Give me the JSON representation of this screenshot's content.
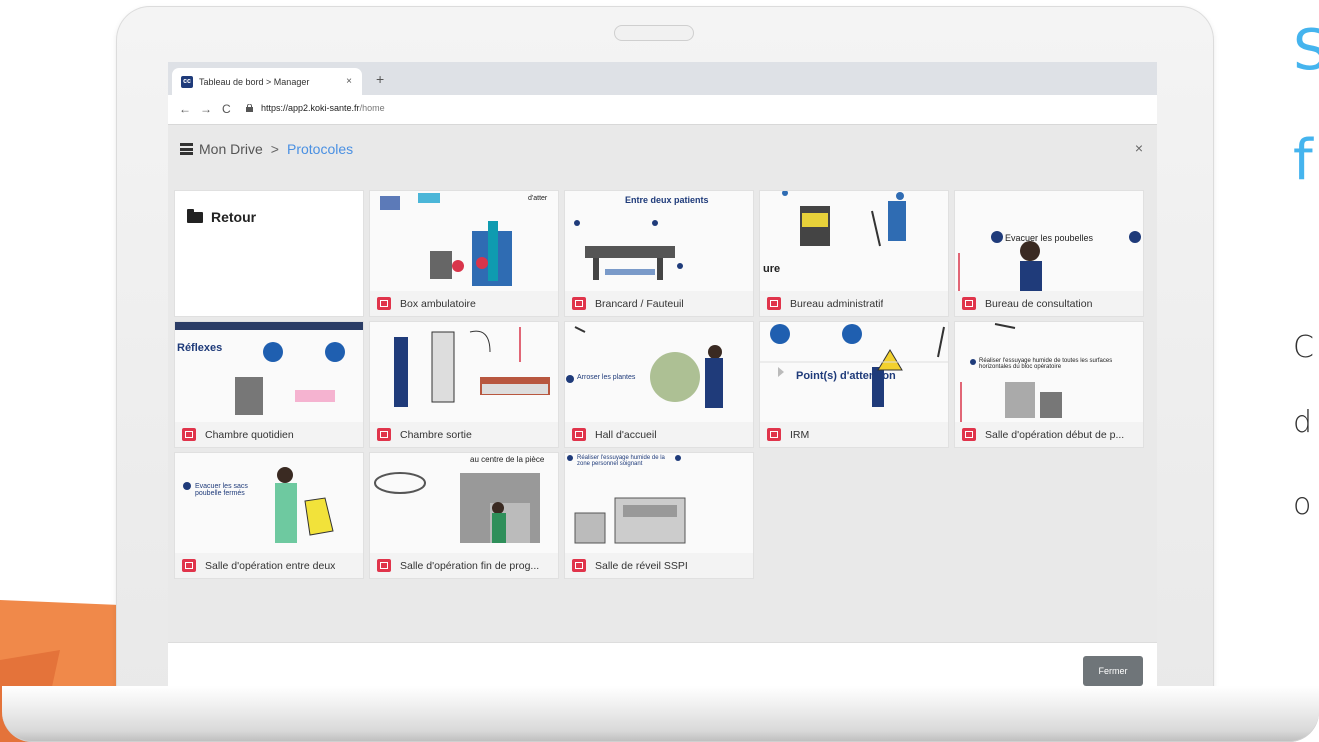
{
  "side_text": {
    "line1": "S",
    "line2": "f",
    "line3": "C",
    "line4": "d",
    "line5": "o"
  },
  "browser": {
    "tab_favicon": "cc",
    "tab_title": "Tableau de bord > Manager",
    "tab_close": "×",
    "new_tab": "+",
    "url_host": "https://app2.koki-sante.fr",
    "url_path": "/home"
  },
  "header": {
    "root": "Mon Drive",
    "separator": ">",
    "current": "Protocoles",
    "close": "×"
  },
  "back_label": "Retour",
  "cards": [
    {
      "label": "Box ambulatoire",
      "thumb_text": "d'atter"
    },
    {
      "label": "Brancard / Fauteuil",
      "thumb_text": "Entre deux patients"
    },
    {
      "label": "Bureau administratif",
      "thumb_text": "ure"
    },
    {
      "label": "Bureau de consultation",
      "thumb_text": "Evacuer les poubelles"
    },
    {
      "label": "Chambre quotidien",
      "thumb_text": "Réflexes"
    },
    {
      "label": "Chambre sortie",
      "thumb_text": ""
    },
    {
      "label": "Hall d'accueil",
      "thumb_text": "Arroser les plantes"
    },
    {
      "label": "IRM",
      "thumb_text": "Point(s) d'attention"
    },
    {
      "label": "Salle d'opération début de p...",
      "thumb_text": "Réaliser l'essuyage humide de toutes les surfaces horizontales du bloc opératoire"
    },
    {
      "label": "Salle d'opération entre deux",
      "thumb_text": "Evacuer les sacs poubelle fermés"
    },
    {
      "label": "Salle d'opération fin de prog...",
      "thumb_text": "au centre de la pièce"
    },
    {
      "label": "Salle de réveil SSPI",
      "thumb_text": "Réaliser l'essuyage humide de la zone personnel soignant"
    }
  ],
  "footer": {
    "close_button": "Fermer"
  },
  "colors": {
    "accent": "#4a90e2",
    "image_icon": "#e0344b",
    "side_text": "#45b4ee",
    "orange": "#f08a4b"
  }
}
